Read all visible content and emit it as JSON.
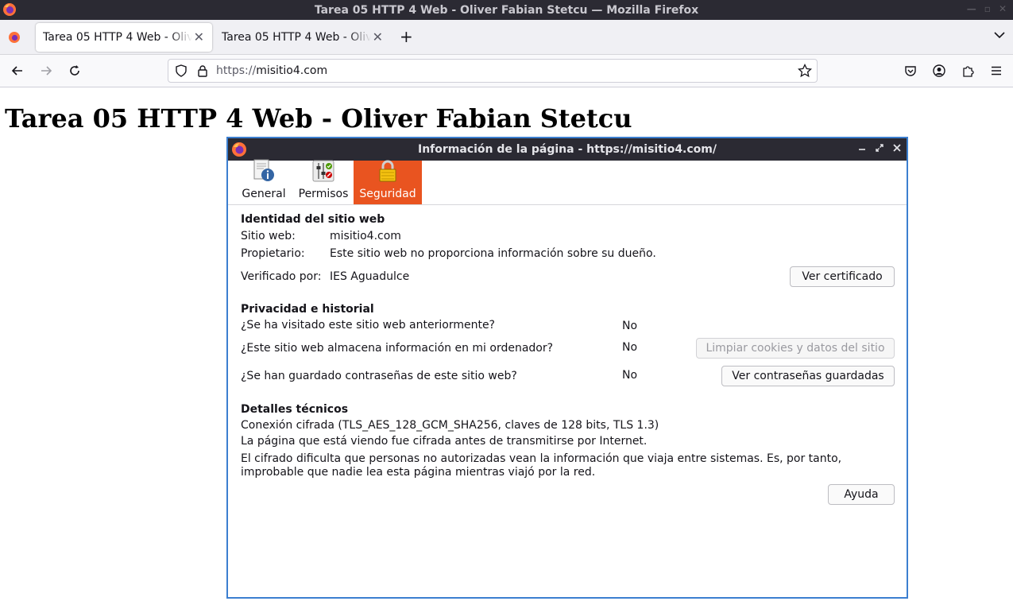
{
  "window": {
    "title": "Tarea 05 HTTP 4 Web - Oliver Fabian Stetcu — Mozilla Firefox"
  },
  "tabs": [
    {
      "label": "Tarea 05 HTTP 4 Web - Oliver Fabian Stetcu",
      "active": true
    },
    {
      "label": "Tarea 05 HTTP 4 Web - Oliver Fabian Stetcu",
      "active": false
    }
  ],
  "urlbar": {
    "scheme": "https://",
    "host": "misitio4.com"
  },
  "page": {
    "heading": "Tarea 05 HTTP 4 Web - Oliver Fabian Stetcu"
  },
  "dialog": {
    "title": "Información de la página - https://misitio4.com/",
    "tabs": [
      {
        "label": "General",
        "icon": "info-page-icon"
      },
      {
        "label": "Permisos",
        "icon": "permissions-icon"
      },
      {
        "label": "Seguridad",
        "icon": "lock-icon",
        "selected": true
      }
    ],
    "identity": {
      "title": "Identidad del sitio web",
      "site_label": "Sitio web:",
      "site_value": "misitio4.com",
      "owner_label": "Propietario:",
      "owner_value": "Este sitio web no proporciona información sobre su dueño.",
      "verified_label": "Verificado por:",
      "verified_value": "IES Aguadulce",
      "view_cert_button": "Ver certificado"
    },
    "privacy": {
      "title": "Privacidad e historial",
      "visited_q": "¿Se ha visitado este sitio web anteriormente?",
      "visited_a": "No",
      "stores_q": "¿Este sitio web almacena información en mi ordenador?",
      "stores_a": "No",
      "clear_button": "Limpiar cookies y datos del sitio",
      "passwords_q": "¿Se han guardado contraseñas de este sitio web?",
      "passwords_a": "No",
      "view_passwords_button": "Ver contraseñas guardadas"
    },
    "technical": {
      "title": "Detalles técnicos",
      "line1": "Conexión cifrada (TLS_AES_128_GCM_SHA256, claves de 128 bits, TLS 1.3)",
      "line2": "La página que está viendo fue cifrada antes de transmitirse por Internet.",
      "line3": "El cifrado dificulta que personas no autorizadas vean la información que viaja entre sistemas. Es, por tanto, improbable que nadie lea esta página mientras viajó por la red."
    },
    "help_button": "Ayuda"
  },
  "colors": {
    "accent": "#e95420",
    "titlebar": "#2b2a33",
    "dialog_border": "#3c7fd0"
  }
}
